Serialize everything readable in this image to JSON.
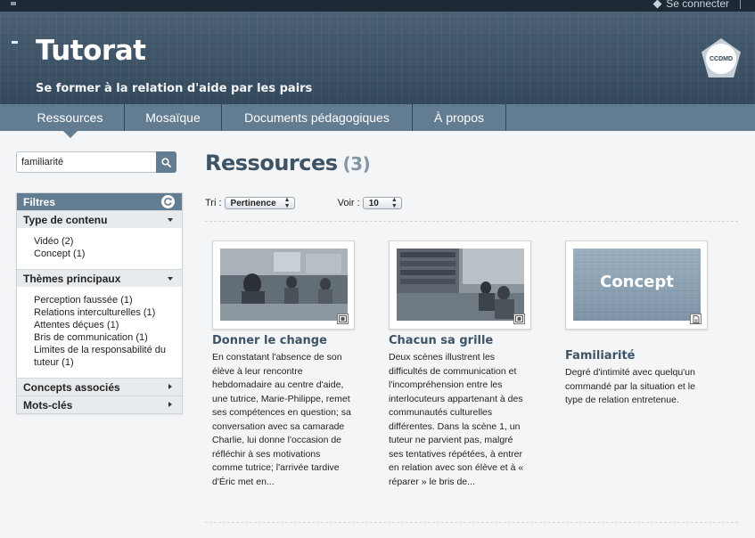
{
  "topbar": {
    "connect_label": "Se connecter"
  },
  "header": {
    "title": "Tutorat",
    "subtitle": "Se former à la relation d'aide par les pairs",
    "logo_text": "CCDMD"
  },
  "nav": {
    "items": [
      {
        "label": "Ressources",
        "active": true
      },
      {
        "label": "Mosaïque"
      },
      {
        "label": "Documents pédagogiques"
      },
      {
        "label": "À propos"
      }
    ]
  },
  "search": {
    "value": "familiarité"
  },
  "filters": {
    "title": "Filtres",
    "sections": [
      {
        "title": "Type de contenu",
        "items": [
          "Vidéo (2)",
          "Concept (1)"
        ]
      },
      {
        "title": "Thèmes principaux",
        "items": [
          "Perception faussée (1)",
          "Relations interculturelles (1)",
          "Attentes déçues (1)",
          "Bris de communication (1)",
          "Limites de la responsabilité du tuteur (1)"
        ]
      },
      {
        "title": "Concepts associés"
      },
      {
        "title": "Mots-clés"
      }
    ]
  },
  "main": {
    "title": "Ressources",
    "count": "(3)",
    "sort_label": "Tri :",
    "sort_value": "Pertinence",
    "view_label": "Voir :",
    "view_value": "10",
    "cards": [
      {
        "title": "Donner le change",
        "description": "En constatant l'absence de son élève à leur rencontre hebdomadaire au centre d'aide, une tutrice, Marie-Philippe, remet ses compétences en question; sa conversation avec sa camarade Charlie, lui donne l'occasion de réfléchir à ses motivations comme tutrice; l'arrivée tardive d'Éric met en..."
      },
      {
        "title": "Chacun sa grille",
        "description": "Deux scènes illustrent les difficultés de communication et l'incompréhension entre les interlocuteurs appartenant à des communautés culturelles différentes. Dans la scène 1, un tuteur ne parvient pas, malgré ses tentatives répétées, à entrer en relation avec son élève et à « réparer » le bris de..."
      },
      {
        "title": "Familiarité",
        "image_label": "Concept",
        "description": "Degré d'intimité avec quelqu'un commandé par la situation et le type de relation entretenue."
      }
    ]
  }
}
